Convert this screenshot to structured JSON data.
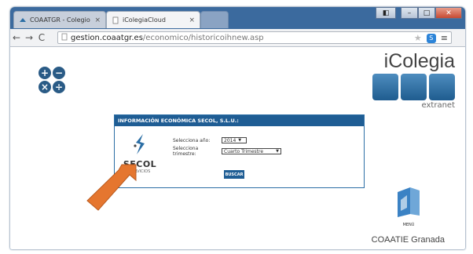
{
  "tabs": [
    {
      "label": "COAATGR - Colegio Ofici"
    },
    {
      "label": "iColegiaCloud"
    }
  ],
  "address": {
    "host": "gestion.coaatgr.es",
    "path": "/economico/historicoihnew.asp"
  },
  "brand": {
    "name": "iColegia",
    "subtitle": "extranet"
  },
  "panel": {
    "title": "INFORMACIÓN ECONÓMICA SECOL, S.L.U.:",
    "logo_text": "SECOL",
    "logo_sub": "SERVICIOS",
    "year_label": "Selecciona año:",
    "year_value": "2014",
    "quarter_label": "Selecciona trimestre:",
    "quarter_value": "Cuarto Trimestre",
    "search_label": "BUSCAR"
  },
  "menu": {
    "label": "MENÚ"
  },
  "footer": "COAATIE Granada",
  "colors": {
    "primary": "#1f5d94",
    "arrow": "#e5762f"
  }
}
